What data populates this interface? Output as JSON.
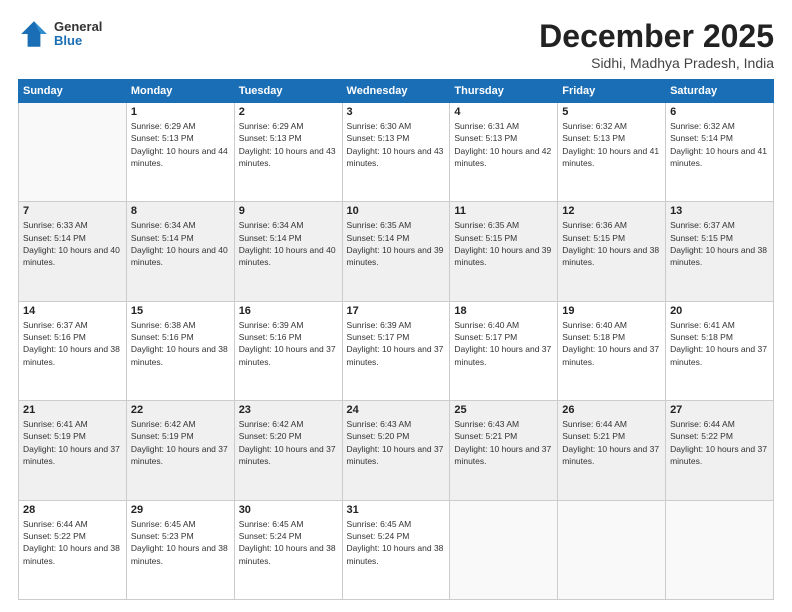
{
  "header": {
    "logo": {
      "general": "General",
      "blue": "Blue"
    },
    "title": "December 2025",
    "location": "Sidhi, Madhya Pradesh, India"
  },
  "days_of_week": [
    "Sunday",
    "Monday",
    "Tuesday",
    "Wednesday",
    "Thursday",
    "Friday",
    "Saturday"
  ],
  "weeks": [
    [
      {
        "day": "",
        "sunrise": "",
        "sunset": "",
        "daylight": ""
      },
      {
        "day": "1",
        "sunrise": "Sunrise: 6:29 AM",
        "sunset": "Sunset: 5:13 PM",
        "daylight": "Daylight: 10 hours and 44 minutes."
      },
      {
        "day": "2",
        "sunrise": "Sunrise: 6:29 AM",
        "sunset": "Sunset: 5:13 PM",
        "daylight": "Daylight: 10 hours and 43 minutes."
      },
      {
        "day": "3",
        "sunrise": "Sunrise: 6:30 AM",
        "sunset": "Sunset: 5:13 PM",
        "daylight": "Daylight: 10 hours and 43 minutes."
      },
      {
        "day": "4",
        "sunrise": "Sunrise: 6:31 AM",
        "sunset": "Sunset: 5:13 PM",
        "daylight": "Daylight: 10 hours and 42 minutes."
      },
      {
        "day": "5",
        "sunrise": "Sunrise: 6:32 AM",
        "sunset": "Sunset: 5:13 PM",
        "daylight": "Daylight: 10 hours and 41 minutes."
      },
      {
        "day": "6",
        "sunrise": "Sunrise: 6:32 AM",
        "sunset": "Sunset: 5:14 PM",
        "daylight": "Daylight: 10 hours and 41 minutes."
      }
    ],
    [
      {
        "day": "7",
        "sunrise": "Sunrise: 6:33 AM",
        "sunset": "Sunset: 5:14 PM",
        "daylight": "Daylight: 10 hours and 40 minutes."
      },
      {
        "day": "8",
        "sunrise": "Sunrise: 6:34 AM",
        "sunset": "Sunset: 5:14 PM",
        "daylight": "Daylight: 10 hours and 40 minutes."
      },
      {
        "day": "9",
        "sunrise": "Sunrise: 6:34 AM",
        "sunset": "Sunset: 5:14 PM",
        "daylight": "Daylight: 10 hours and 40 minutes."
      },
      {
        "day": "10",
        "sunrise": "Sunrise: 6:35 AM",
        "sunset": "Sunset: 5:14 PM",
        "daylight": "Daylight: 10 hours and 39 minutes."
      },
      {
        "day": "11",
        "sunrise": "Sunrise: 6:35 AM",
        "sunset": "Sunset: 5:15 PM",
        "daylight": "Daylight: 10 hours and 39 minutes."
      },
      {
        "day": "12",
        "sunrise": "Sunrise: 6:36 AM",
        "sunset": "Sunset: 5:15 PM",
        "daylight": "Daylight: 10 hours and 38 minutes."
      },
      {
        "day": "13",
        "sunrise": "Sunrise: 6:37 AM",
        "sunset": "Sunset: 5:15 PM",
        "daylight": "Daylight: 10 hours and 38 minutes."
      }
    ],
    [
      {
        "day": "14",
        "sunrise": "Sunrise: 6:37 AM",
        "sunset": "Sunset: 5:16 PM",
        "daylight": "Daylight: 10 hours and 38 minutes."
      },
      {
        "day": "15",
        "sunrise": "Sunrise: 6:38 AM",
        "sunset": "Sunset: 5:16 PM",
        "daylight": "Daylight: 10 hours and 38 minutes."
      },
      {
        "day": "16",
        "sunrise": "Sunrise: 6:39 AM",
        "sunset": "Sunset: 5:16 PM",
        "daylight": "Daylight: 10 hours and 37 minutes."
      },
      {
        "day": "17",
        "sunrise": "Sunrise: 6:39 AM",
        "sunset": "Sunset: 5:17 PM",
        "daylight": "Daylight: 10 hours and 37 minutes."
      },
      {
        "day": "18",
        "sunrise": "Sunrise: 6:40 AM",
        "sunset": "Sunset: 5:17 PM",
        "daylight": "Daylight: 10 hours and 37 minutes."
      },
      {
        "day": "19",
        "sunrise": "Sunrise: 6:40 AM",
        "sunset": "Sunset: 5:18 PM",
        "daylight": "Daylight: 10 hours and 37 minutes."
      },
      {
        "day": "20",
        "sunrise": "Sunrise: 6:41 AM",
        "sunset": "Sunset: 5:18 PM",
        "daylight": "Daylight: 10 hours and 37 minutes."
      }
    ],
    [
      {
        "day": "21",
        "sunrise": "Sunrise: 6:41 AM",
        "sunset": "Sunset: 5:19 PM",
        "daylight": "Daylight: 10 hours and 37 minutes."
      },
      {
        "day": "22",
        "sunrise": "Sunrise: 6:42 AM",
        "sunset": "Sunset: 5:19 PM",
        "daylight": "Daylight: 10 hours and 37 minutes."
      },
      {
        "day": "23",
        "sunrise": "Sunrise: 6:42 AM",
        "sunset": "Sunset: 5:20 PM",
        "daylight": "Daylight: 10 hours and 37 minutes."
      },
      {
        "day": "24",
        "sunrise": "Sunrise: 6:43 AM",
        "sunset": "Sunset: 5:20 PM",
        "daylight": "Daylight: 10 hours and 37 minutes."
      },
      {
        "day": "25",
        "sunrise": "Sunrise: 6:43 AM",
        "sunset": "Sunset: 5:21 PM",
        "daylight": "Daylight: 10 hours and 37 minutes."
      },
      {
        "day": "26",
        "sunrise": "Sunrise: 6:44 AM",
        "sunset": "Sunset: 5:21 PM",
        "daylight": "Daylight: 10 hours and 37 minutes."
      },
      {
        "day": "27",
        "sunrise": "Sunrise: 6:44 AM",
        "sunset": "Sunset: 5:22 PM",
        "daylight": "Daylight: 10 hours and 37 minutes."
      }
    ],
    [
      {
        "day": "28",
        "sunrise": "Sunrise: 6:44 AM",
        "sunset": "Sunset: 5:22 PM",
        "daylight": "Daylight: 10 hours and 38 minutes."
      },
      {
        "day": "29",
        "sunrise": "Sunrise: 6:45 AM",
        "sunset": "Sunset: 5:23 PM",
        "daylight": "Daylight: 10 hours and 38 minutes."
      },
      {
        "day": "30",
        "sunrise": "Sunrise: 6:45 AM",
        "sunset": "Sunset: 5:24 PM",
        "daylight": "Daylight: 10 hours and 38 minutes."
      },
      {
        "day": "31",
        "sunrise": "Sunrise: 6:45 AM",
        "sunset": "Sunset: 5:24 PM",
        "daylight": "Daylight: 10 hours and 38 minutes."
      },
      {
        "day": "",
        "sunrise": "",
        "sunset": "",
        "daylight": ""
      },
      {
        "day": "",
        "sunrise": "",
        "sunset": "",
        "daylight": ""
      },
      {
        "day": "",
        "sunrise": "",
        "sunset": "",
        "daylight": ""
      }
    ]
  ]
}
